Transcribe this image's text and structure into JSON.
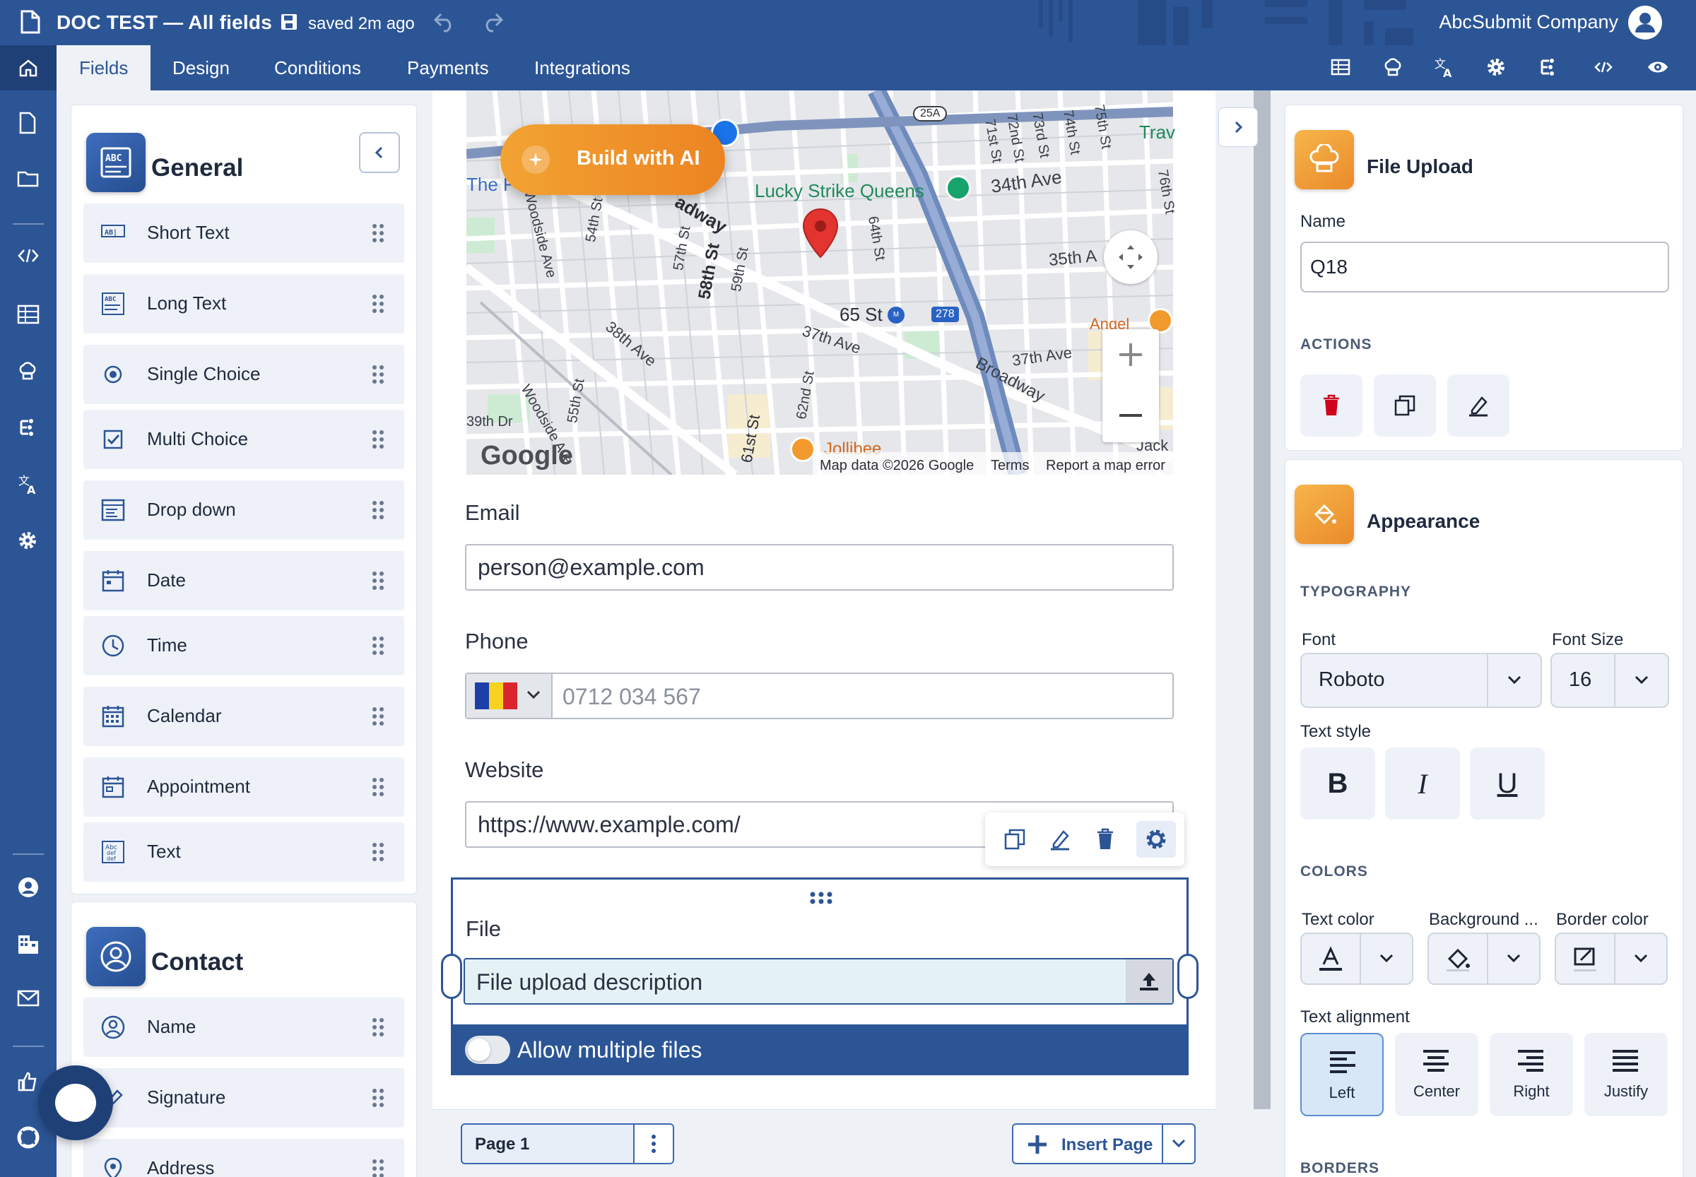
{
  "header": {
    "doc_title": "DOC TEST — All fields",
    "saved_status": "saved 2m ago",
    "company": "AbcSubmit Company"
  },
  "tabs": [
    {
      "label": "Fields",
      "active": true
    },
    {
      "label": "Design",
      "active": false
    },
    {
      "label": "Conditions",
      "active": false
    },
    {
      "label": "Payments",
      "active": false
    },
    {
      "label": "Integrations",
      "active": false
    }
  ],
  "palette": {
    "general": {
      "title": "General",
      "items": [
        {
          "label": "Short Text",
          "icon": "short-text-icon"
        },
        {
          "label": "Long Text",
          "icon": "long-text-icon"
        },
        {
          "label": "Single Choice",
          "icon": "radio-icon"
        },
        {
          "label": "Multi Choice",
          "icon": "checkbox-icon"
        },
        {
          "label": "Drop down",
          "icon": "dropdown-icon"
        },
        {
          "label": "Date",
          "icon": "date-icon"
        },
        {
          "label": "Time",
          "icon": "clock-icon"
        },
        {
          "label": "Calendar",
          "icon": "calendar-icon"
        },
        {
          "label": "Appointment",
          "icon": "appointment-icon"
        },
        {
          "label": "Text",
          "icon": "text-icon"
        }
      ]
    },
    "contact": {
      "title": "Contact",
      "items": [
        {
          "label": "Name",
          "icon": "person-icon"
        },
        {
          "label": "Signature",
          "icon": "signature-icon"
        },
        {
          "label": "Address",
          "icon": "location-icon"
        }
      ]
    }
  },
  "map": {
    "build_ai_label": "Build with AI",
    "labels": {
      "lucky_strike": "Lucky Strike Queens",
      "st65": "65 St",
      "ave34": "34th Ave",
      "ave37a": "37th Ave",
      "ave37b": "37th Ave",
      "broadway": "Broadway",
      "google": "Google",
      "attribution": "Map data ©2026 Google",
      "terms": "Terms",
      "report": "Report a map error",
      "jollibee": "Jollibee",
      "angel": "Angel",
      "st35": "35th A",
      "ave38": "38th Ave",
      "woodside1": "Woodside Ave",
      "woodside2": "Woodside Ave",
      "st58": "58th St",
      "st57": "57th St",
      "st54": "54th St",
      "st55": "55th St",
      "st59": "59th St",
      "st61": "61st St",
      "st62": "62nd St",
      "st64": "64th St",
      "st71": "71st St",
      "st72": "72nd St",
      "st73": "73rd St",
      "st74": "74th St",
      "st75": "75th St",
      "st76": "76th St",
      "dr39": "39th Dr",
      "the": "The F",
      "trav": "Trav",
      "jack": "Jack",
      "route25a": "25A",
      "route278": "278",
      "broadway_frag": "adway"
    }
  },
  "form": {
    "email": {
      "label": "Email",
      "value": "person@example.com"
    },
    "phone": {
      "label": "Phone",
      "placeholder": "0712 034 567"
    },
    "website": {
      "label": "Website",
      "value": "https://www.example.com/"
    },
    "file": {
      "label": "File",
      "description": "File upload description",
      "multiple_label": "Allow multiple files"
    }
  },
  "pagebar": {
    "page_label": "Page 1",
    "insert_label": "Insert Page"
  },
  "properties": {
    "title": "File Upload",
    "name_label": "Name",
    "name_value": "Q18",
    "actions_label": "ACTIONS",
    "appearance_title": "Appearance",
    "typography_label": "TYPOGRAPHY",
    "font_label": "Font",
    "font_value": "Roboto",
    "font_size_label": "Font Size",
    "font_size_value": "16",
    "text_style_label": "Text style",
    "bold": "B",
    "italic": "I",
    "underline": "U",
    "colors_label": "COLORS",
    "text_color_label": "Text color",
    "background_label": "Background ...",
    "border_color_label": "Border color",
    "alignment_label": "Text alignment",
    "alignments": [
      "Left",
      "Center",
      "Right",
      "Justify"
    ],
    "active_alignment": "Left",
    "borders_label": "BORDERS"
  },
  "colors": {
    "brand": "#2c5596",
    "accent_orange": "#ee8a26",
    "delete_red": "#d0021b"
  }
}
